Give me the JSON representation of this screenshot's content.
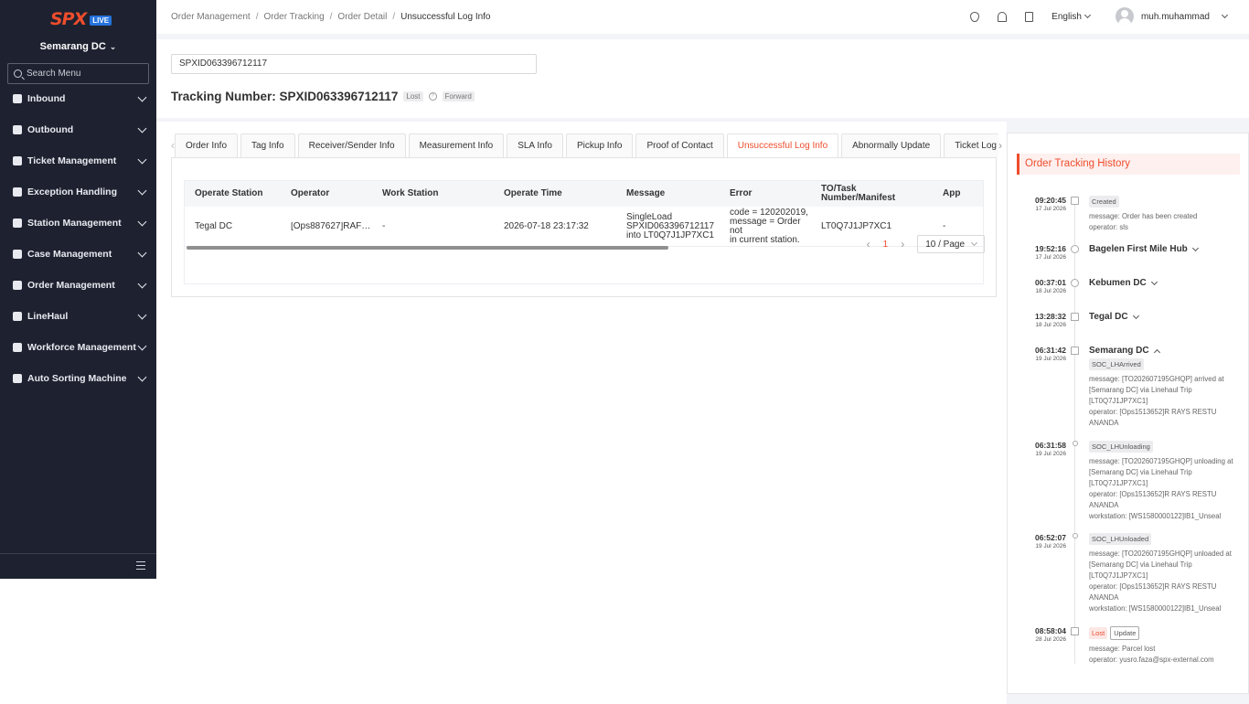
{
  "sidebar": {
    "logo_text": "SPX",
    "logo_badge": "LIVE",
    "station": "Semarang DC",
    "search_placeholder": "Search Menu",
    "items": [
      {
        "label": "Inbound"
      },
      {
        "label": "Outbound"
      },
      {
        "label": "Ticket Management"
      },
      {
        "label": "Exception Handling"
      },
      {
        "label": "Station Management"
      },
      {
        "label": "Case Management"
      },
      {
        "label": "Order Management"
      },
      {
        "label": "LineHaul"
      },
      {
        "label": "Workforce Management"
      },
      {
        "label": "Auto Sorting Machine"
      }
    ]
  },
  "header": {
    "breadcrumb": [
      "Order Management",
      "Order Tracking",
      "Order Detail",
      "Unsuccessful Log Info"
    ],
    "language": "English",
    "username": "muh.muhammad"
  },
  "search": {
    "value": "SPXID063396712117",
    "title_label": "Tracking Number: SPXID063396712117",
    "status_tag": "Lost",
    "direction_tag": "Forward"
  },
  "tabs": [
    "Order Info",
    "Tag Info",
    "Receiver/Sender Info",
    "Measurement Info",
    "SLA Info",
    "Pickup Info",
    "Proof of Contact",
    "Unsuccessful Log Info",
    "Abnormally Update",
    "Ticket Log"
  ],
  "active_tab": "Unsuccessful Log Info",
  "table": {
    "headers": [
      "Operate Station",
      "Operator",
      "Work Station",
      "Operate Time",
      "Message",
      "Error",
      "TO/Task Number/Manifest",
      "App"
    ],
    "rows": [
      {
        "station": "Tegal DC",
        "operator": "[Ops887627]RAFI P...",
        "work_station": "-",
        "time": "2026-07-18 23:17:32",
        "message_1": "SingleLoad",
        "message_2": "SPXID063396712117",
        "message_3": "into LT0Q7J1JP7XC1",
        "error_1": "code = 120202019,",
        "error_2": "message = Order not",
        "error_3": "in current station.",
        "to_number": "LT0Q7J1JP7XC1",
        "app": "-"
      }
    ]
  },
  "pagination": {
    "current": "1",
    "page_size": "10 / Page"
  },
  "history": {
    "title": "Order Tracking History",
    "events": [
      {
        "time": "09:20:45",
        "date": "17 Jul 2026",
        "tag": "Created",
        "msg": "message: Order has been created",
        "op": "operator: sls"
      },
      {
        "time": "19:52:16",
        "date": "17 Jul 2026",
        "station": "Bagelen First Mile Hub"
      },
      {
        "time": "00:37:01",
        "date": "18 Jul 2026",
        "station": "Kebumen DC"
      },
      {
        "time": "13:28:32",
        "date": "18 Jul 2026",
        "station": "Tegal DC"
      },
      {
        "time": "06:31:42",
        "date": "19 Jul 2026",
        "station": "Semarang DC",
        "tag": "SOC_LHArrived",
        "msg": "message: [TO202607195GHQP] arrived at [Semarang DC] via Linehaul Trip [LT0Q7J1JP7XC1]",
        "op": "operator: [Ops1513652]R RAYS RESTU ANANDA"
      },
      {
        "time": "06:31:58",
        "date": "19 Jul 2026",
        "tag": "SOC_LHUnloading",
        "msg": "message: [TO202607195GHQP] unloading at [Semarang DC] via Linehaul Trip [LT0Q7J1JP7XC1]",
        "op": "operator: [Ops1513652]R RAYS RESTU ANANDA",
        "ws": "workstation: [WS1580000122]IB1_Unseal"
      },
      {
        "time": "06:52:07",
        "date": "19 Jul 2026",
        "tag": "SOC_LHUnloaded",
        "msg": "message: [TO202607195GHQP] unloaded at [Semarang DC] via Linehaul Trip [LT0Q7J1JP7XC1]",
        "op": "operator: [Ops1513652]R RAYS RESTU ANANDA",
        "ws": "workstation: [WS1580000122]IB1_Unseal"
      },
      {
        "time": "08:58:04",
        "date": "28 Jul 2026",
        "tag": "Lost",
        "tag2": "Update",
        "msg": "message: Parcel lost",
        "op": "operator: yusro.faza@spx-external.com"
      }
    ]
  },
  "colors": {
    "accent": "#ee4d2d",
    "sidebar_bg": "#1e2230",
    "live_badge": "#2673dd"
  }
}
